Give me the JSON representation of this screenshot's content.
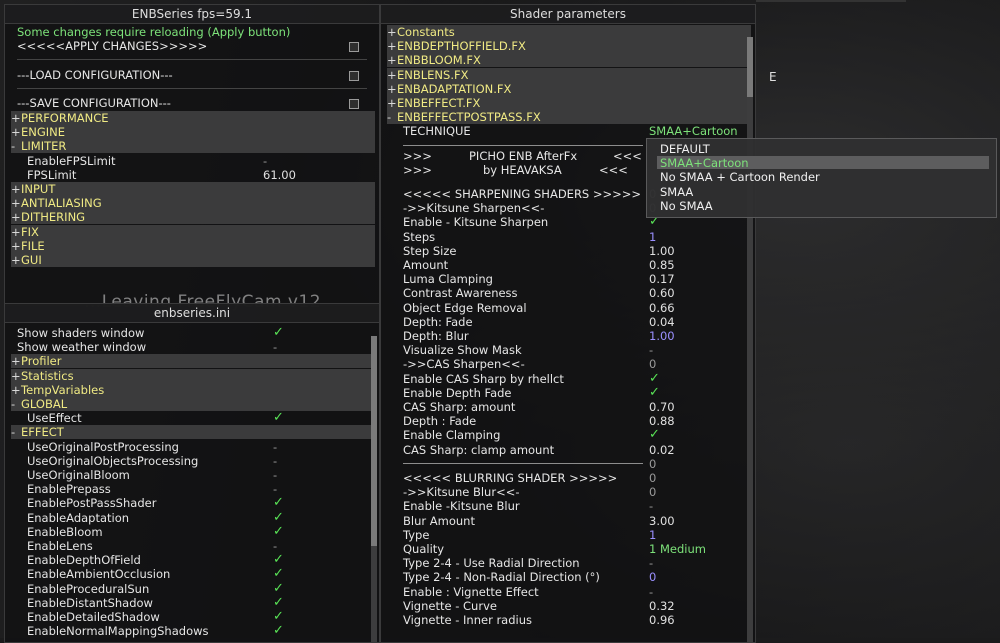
{
  "background": {
    "letter": "E"
  },
  "overlay_text": "...Leaving FreeFlyCam v12",
  "enbseries": {
    "title": "ENBSeries  fps=59.1",
    "notice": "Some changes require reloading (Apply button)",
    "apply": "<<<<<APPLY CHANGES>>>>>",
    "load": "---LOAD CONFIGURATION---",
    "save": "---SAVE CONFIGURATION---",
    "sections": [
      "PERFORMANCE",
      "ENGINE",
      "LIMITER"
    ],
    "limiter_items": [
      {
        "label": "EnableFPSLimit",
        "value": "-"
      },
      {
        "label": "FPSLimit",
        "value": "61.00"
      }
    ],
    "sections2": [
      "INPUT",
      "ANTIALIASING",
      "DITHERING",
      "FIX",
      "FILE",
      "GUI"
    ]
  },
  "enbini": {
    "title": "enbseries.ini",
    "top_items": [
      {
        "label": "Show shaders window",
        "value": "✓"
      },
      {
        "label": "Show weather window",
        "value": "-"
      }
    ],
    "sections": [
      "Profiler",
      "Statistics",
      "TempVariables",
      "GLOBAL"
    ],
    "global_items": [
      {
        "label": "UseEffect",
        "value": "✓"
      }
    ],
    "effect_section": "EFFECT",
    "effect_items": [
      {
        "label": "UseOriginalPostProcessing",
        "value": "-"
      },
      {
        "label": "UseOriginalObjectsProcessing",
        "value": "-"
      },
      {
        "label": "UseOriginalBloom",
        "value": "-"
      },
      {
        "label": "EnablePrepass",
        "value": "-"
      },
      {
        "label": "EnablePostPassShader",
        "value": "✓"
      },
      {
        "label": "EnableAdaptation",
        "value": "✓"
      },
      {
        "label": "EnableBloom",
        "value": "✓"
      },
      {
        "label": "EnableLens",
        "value": "-"
      },
      {
        "label": "EnableDepthOfField",
        "value": "✓"
      },
      {
        "label": "EnableAmbientOcclusion",
        "value": "✓"
      },
      {
        "label": "EnableProceduralSun",
        "value": "✓"
      },
      {
        "label": "EnableDistantShadow",
        "value": "✓"
      },
      {
        "label": "EnableDetailedShadow",
        "value": "✓"
      },
      {
        "label": "EnableNormalMappingShadows",
        "value": "✓"
      }
    ]
  },
  "shader": {
    "title": "Shader parameters",
    "files": [
      "Constants",
      "ENBDEPTHOFFIELD.FX",
      "ENBBLOOM.FX",
      "ENBLENS.FX",
      "ENBADAPTATION.FX",
      "ENBEFFECT.FX",
      "ENBEFFECTPOSTPASS.FX"
    ],
    "expanded_prefix": "-",
    "technique_label": "TECHNIQUE",
    "technique_value": "SMAA+Cartoon",
    "banner": [
      {
        "left": ">>>",
        "mid": "PICHO ENB AfterFx",
        "right": "<<<"
      },
      {
        "left": ">>>",
        "mid": "by HEAVAKSA",
        "right": "<<<"
      }
    ],
    "params": [
      {
        "label": "<<<<< SHARPENING SHADERS >>>>>",
        "value": "0",
        "type": "dash"
      },
      {
        "label": "->>Kitsune Sharpen<<-",
        "value": "0",
        "type": "dash"
      },
      {
        "label": "Enable - Kitsune Sharpen",
        "value": "✓",
        "type": "chk"
      },
      {
        "label": "Steps",
        "value": "1",
        "type": "blue"
      },
      {
        "label": "Step Size",
        "value": "1.00",
        "type": "num"
      },
      {
        "label": "Amount",
        "value": "0.85",
        "type": "num"
      },
      {
        "label": "Luma Clamping",
        "value": "0.17",
        "type": "num"
      },
      {
        "label": "Contrast Awareness",
        "value": "0.60",
        "type": "num"
      },
      {
        "label": "Object Edge Removal",
        "value": "0.66",
        "type": "num"
      },
      {
        "label": "Depth: Fade",
        "value": "0.04",
        "type": "num"
      },
      {
        "label": "Depth: Blur",
        "value": "1.00",
        "type": "blue"
      },
      {
        "label": "Visualize Show Mask",
        "value": "-",
        "type": "dash"
      },
      {
        "label": "->>CAS Sharpen<<-",
        "value": "0",
        "type": "dash"
      },
      {
        "label": "Enable CAS Sharp by rhellct",
        "value": "✓",
        "type": "chk"
      },
      {
        "label": "Enable Depth Fade",
        "value": "✓",
        "type": "chk"
      },
      {
        "label": "CAS Sharp: amount",
        "value": "0.70",
        "type": "num"
      },
      {
        "label": "Depth : Fade",
        "value": "0.88",
        "type": "num"
      },
      {
        "label": "Enable Clamping",
        "value": "✓",
        "type": "chk"
      },
      {
        "label": "CAS Sharp: clamp amount",
        "value": "0.02",
        "type": "num"
      },
      {
        "label": "",
        "value": "0",
        "type": "dash"
      },
      {
        "label": "<<<<< BLURRING SHADER >>>>>",
        "value": "0",
        "type": "dash"
      },
      {
        "label": "->>Kitsune Blur<<-",
        "value": "0",
        "type": "dash"
      },
      {
        "label": "Enable -Kitsune Blur",
        "value": "-",
        "type": "dash"
      },
      {
        "label": "Blur Amount",
        "value": "3.00",
        "type": "num"
      },
      {
        "label": "Type",
        "value": "1",
        "type": "blue"
      },
      {
        "label": "Quality",
        "value": "1 Medium",
        "type": "green"
      },
      {
        "label": "Type 2-4 - Use Radial Direction",
        "value": "-",
        "type": "dash"
      },
      {
        "label": "Type 2-4 - Non-Radial Direction (°)",
        "value": "0",
        "type": "blue"
      },
      {
        "label": "Enable : Vignette Effect",
        "value": "-",
        "type": "dash"
      },
      {
        "label": "Vignette - Curve",
        "value": "0.32",
        "type": "num"
      },
      {
        "label": "Vignette - Inner radius",
        "value": "0.96",
        "type": "num"
      }
    ],
    "dropdown": {
      "options": [
        "DEFAULT",
        "SMAA+Cartoon",
        "No SMAA + Cartoon Render",
        "SMAA",
        "No SMAA"
      ],
      "selected": "SMAA+Cartoon"
    }
  },
  "colors": {
    "accent_yellow": "#f0ea84",
    "check_green": "#59e356",
    "header_bg": "#3b3b3c",
    "blue_value": "#9b90ff"
  }
}
